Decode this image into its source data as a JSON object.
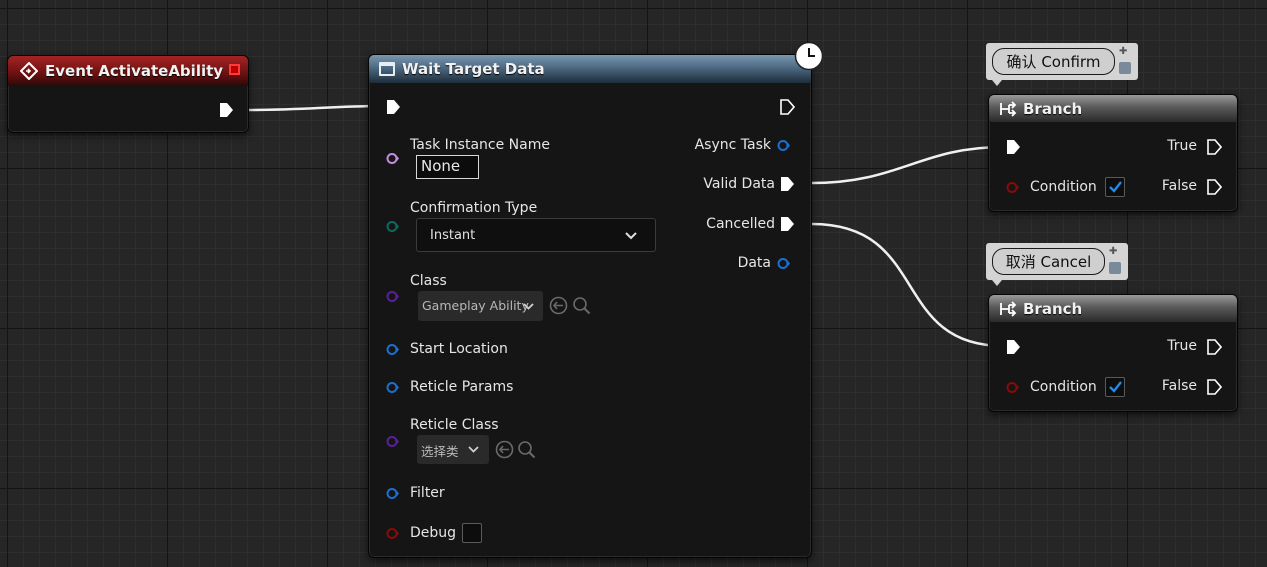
{
  "event_node": {
    "title": "Event ActivateAbility"
  },
  "wait_node": {
    "title": "Wait Target Data",
    "inputs": {
      "task_instance_name": {
        "label": "Task Instance Name",
        "value": "None"
      },
      "confirmation_type": {
        "label": "Confirmation Type",
        "value": "Instant"
      },
      "class": {
        "label": "Class",
        "value": "Gameplay Ability"
      },
      "start_location": {
        "label": "Start Location"
      },
      "reticle_params": {
        "label": "Reticle Params"
      },
      "reticle_class": {
        "label": "Reticle Class",
        "value": "选择类"
      },
      "filter": {
        "label": "Filter"
      },
      "debug": {
        "label": "Debug",
        "checked": false
      }
    },
    "outputs": {
      "async_task": "Async Task",
      "valid_data": "Valid Data",
      "cancelled": "Cancelled",
      "data": "Data"
    }
  },
  "branch_confirm": {
    "comment": "确认 Confirm",
    "title": "Branch",
    "condition_label": "Condition",
    "condition_checked": true,
    "true_label": "True",
    "false_label": "False"
  },
  "branch_cancel": {
    "comment": "取消 Cancel",
    "title": "Branch",
    "condition_label": "Condition",
    "condition_checked": true,
    "true_label": "True",
    "false_label": "False"
  },
  "colors": {
    "event_header": "#8a1a1a",
    "wait_header": "#4d6a82",
    "branch_header": "#5a5a5a",
    "exec_pin": "#ffffff",
    "struct_pin": "#1a6fd1",
    "object_pin": "#8e3cc9",
    "name_pin": "#c48ce0",
    "enum_pin": "#0b6b5e",
    "bool_pin": "#8a0a0a",
    "check_accent": "#2b88e0"
  }
}
